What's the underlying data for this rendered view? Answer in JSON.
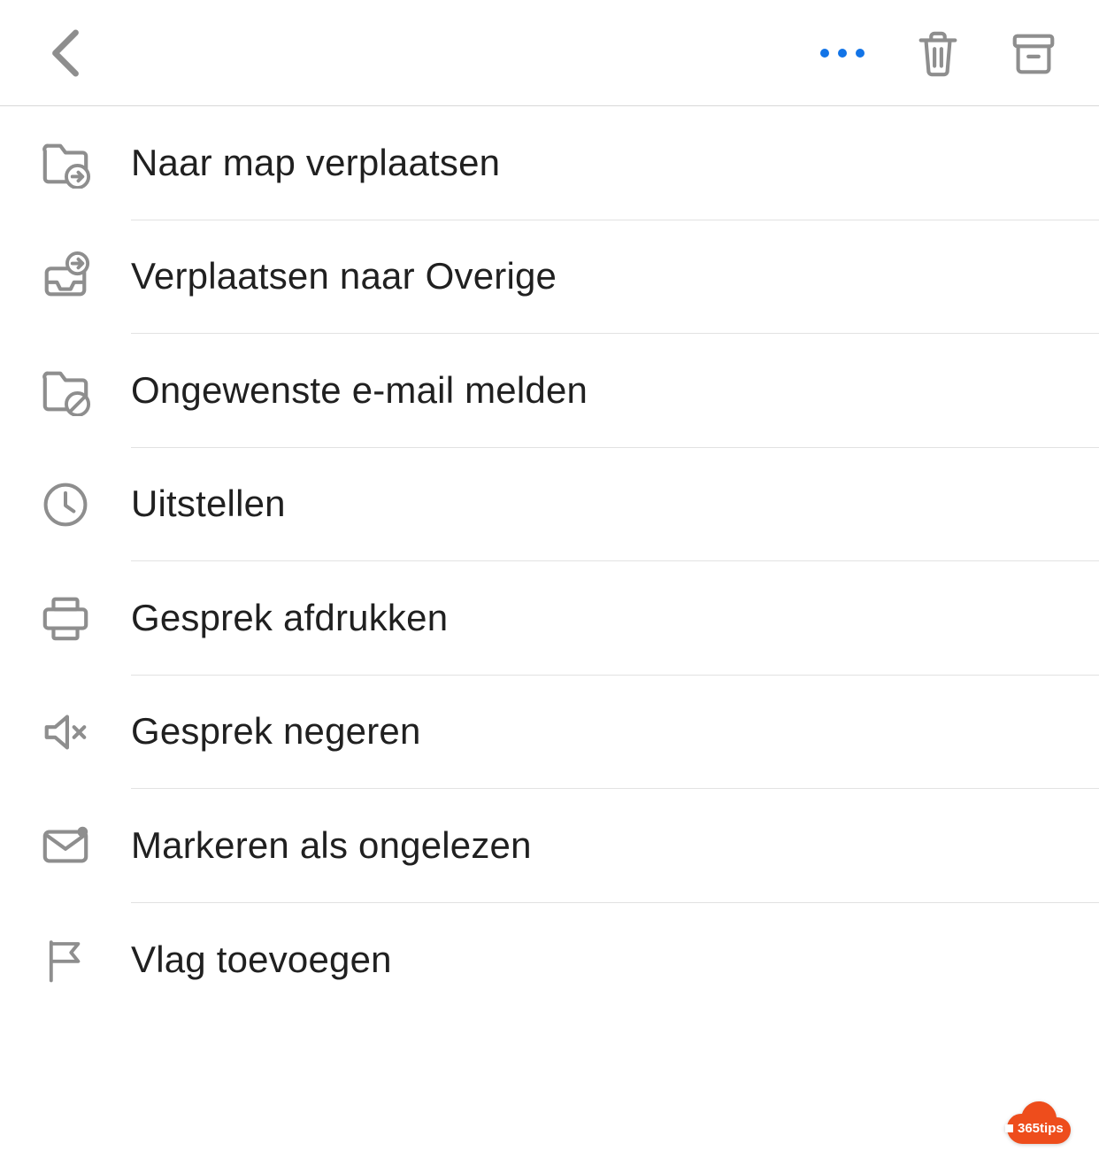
{
  "header": {
    "back_label": "Back",
    "more_label": "More options",
    "delete_label": "Delete",
    "archive_label": "Archive"
  },
  "menu": {
    "items": [
      {
        "icon": "folder-move-icon",
        "label": "Naar map verplaatsen"
      },
      {
        "icon": "move-other-icon",
        "label": "Verplaatsen naar Overige"
      },
      {
        "icon": "folder-block-icon",
        "label": "Ongewenste e-mail melden"
      },
      {
        "icon": "clock-icon",
        "label": "Uitstellen"
      },
      {
        "icon": "print-icon",
        "label": "Gesprek afdrukken"
      },
      {
        "icon": "mute-icon",
        "label": "Gesprek negeren"
      },
      {
        "icon": "mail-unread-icon",
        "label": "Markeren als ongelezen"
      },
      {
        "icon": "flag-icon",
        "label": "Vlag toevoegen"
      }
    ]
  },
  "badge": {
    "text": "365tips"
  },
  "colors": {
    "accent": "#1274e7",
    "icon": "#8e8e8e",
    "brand": "#ee4d1c"
  }
}
